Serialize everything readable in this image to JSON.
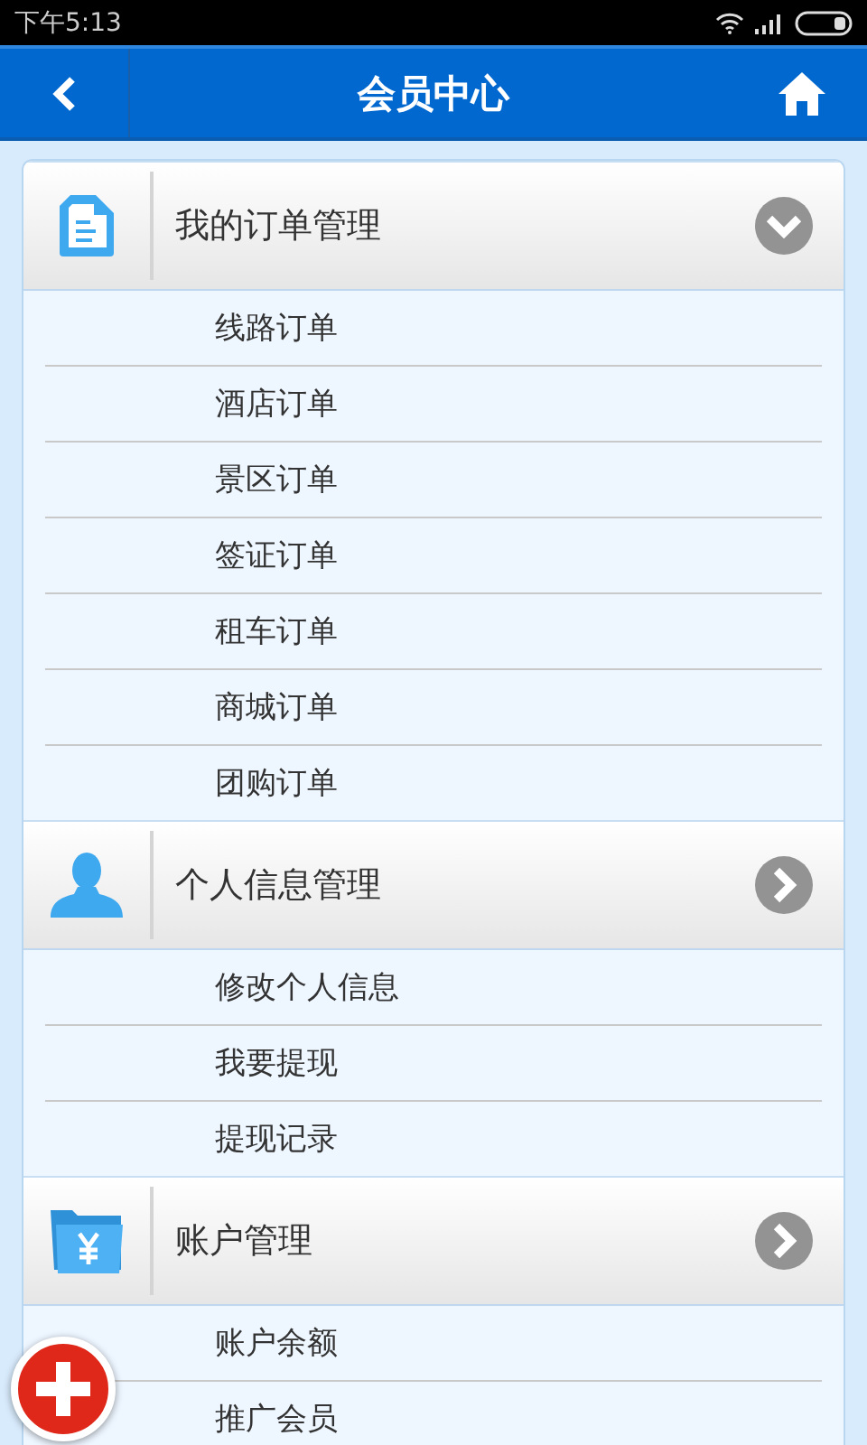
{
  "status_bar": {
    "time": "下午5:13"
  },
  "header": {
    "title": "会员中心"
  },
  "sections": [
    {
      "kind": "document",
      "title": "我的订单管理",
      "expanded": true,
      "items": [
        "线路订单",
        "酒店订单",
        "景区订单",
        "签证订单",
        "租车订单",
        "商城订单",
        "团购订单"
      ]
    },
    {
      "kind": "person",
      "title": "个人信息管理",
      "expanded": false,
      "items": [
        "修改个人信息",
        "我要提现",
        "提现记录"
      ]
    },
    {
      "kind": "wallet",
      "title": "账户管理",
      "expanded": false,
      "items": [
        "账户余额",
        "推广会员"
      ]
    }
  ]
}
